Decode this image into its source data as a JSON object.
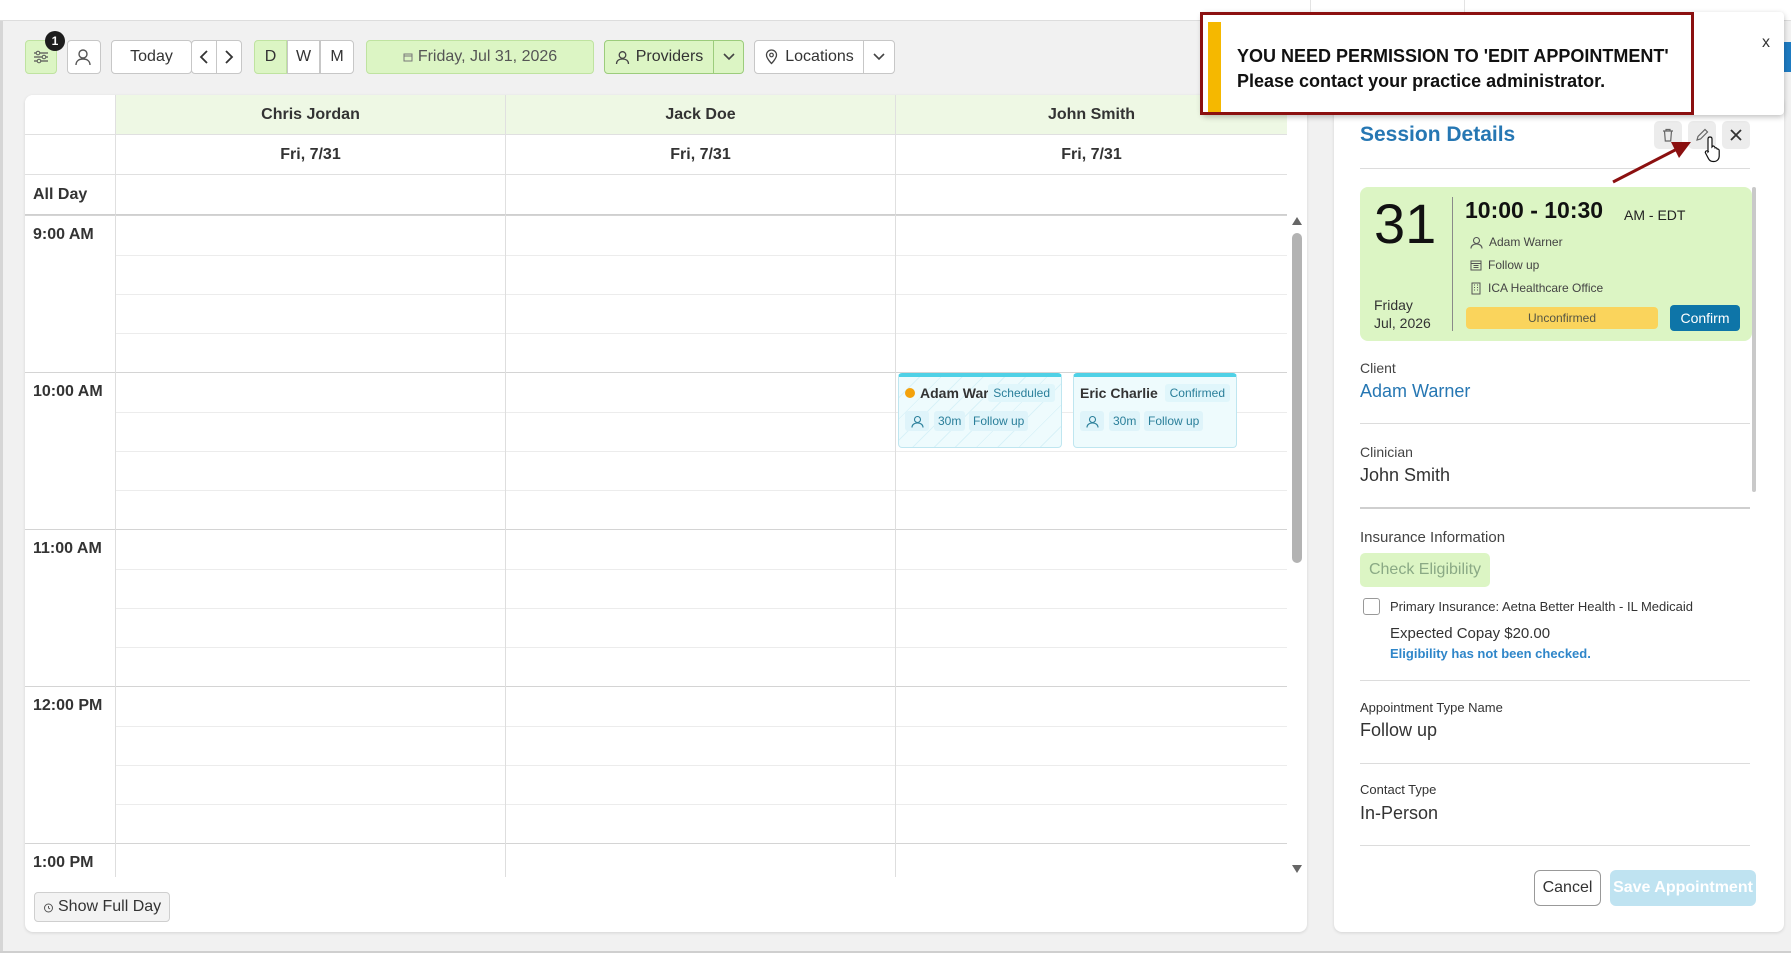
{
  "toolbar": {
    "filter_badge": "1",
    "today_label": "Today",
    "view_day": "D",
    "view_week": "W",
    "view_month": "M",
    "date_label": "Friday, Jul 31, 2026",
    "providers_label": "Providers",
    "locations_label": "Locations"
  },
  "calendar": {
    "providers": [
      {
        "name": "Chris Jordan",
        "date": "Fri, 7/31"
      },
      {
        "name": "Jack Doe",
        "date": "Fri, 7/31"
      },
      {
        "name": "John Smith",
        "date": "Fri, 7/31"
      }
    ],
    "all_day_label": "All Day",
    "times": [
      "9:00 AM",
      "10:00 AM",
      "11:00 AM",
      "12:00 PM",
      "1:00 PM"
    ],
    "appointments": [
      {
        "name": "Adam War...",
        "status": "Scheduled",
        "duration": "30m",
        "type": "Follow up"
      },
      {
        "name": "Eric Charlie",
        "status": "Confirmed",
        "duration": "30m",
        "type": "Follow up"
      }
    ],
    "show_full_day": "Show Full Day"
  },
  "session": {
    "title": "Session Details",
    "day_number": "31",
    "weekday": "Friday",
    "month_year": "Jul, 2026",
    "time_range": "10:00 - 10:30",
    "timezone": "AM - EDT",
    "client_short": "Adam Warner",
    "appt_type_short": "Follow up",
    "location": "ICA Healthcare Office",
    "status": "Unconfirmed",
    "confirm_label": "Confirm",
    "client_label": "Client",
    "client_value": "Adam Warner",
    "clinician_label": "Clinician",
    "clinician_value": "John Smith",
    "insurance_label": "Insurance Information",
    "check_eligibility": "Check Eligibility",
    "primary_insurance": "Primary Insurance: Aetna Better Health - IL Medicaid",
    "expected_copay": "Expected Copay $20.00",
    "eligibility_note": "Eligibility has not been checked.",
    "appt_type_label": "Appointment Type Name",
    "appt_type_value": "Follow up",
    "contact_type_label": "Contact Type",
    "contact_type_value": "In-Person",
    "cancel_label": "Cancel",
    "save_label": "Save Appointment"
  },
  "toast": {
    "line1": "YOU NEED PERMISSION TO 'EDIT APPOINTMENT'",
    "line2": "Please contact your practice administrator.",
    "close": "x"
  },
  "colors": {
    "accent_green": "#dcf5c4",
    "link_blue": "#2677b3",
    "confirm_blue": "#0e75a8",
    "unconfirmed_yellow": "#fad45c",
    "annotation_red": "#8b1010"
  }
}
